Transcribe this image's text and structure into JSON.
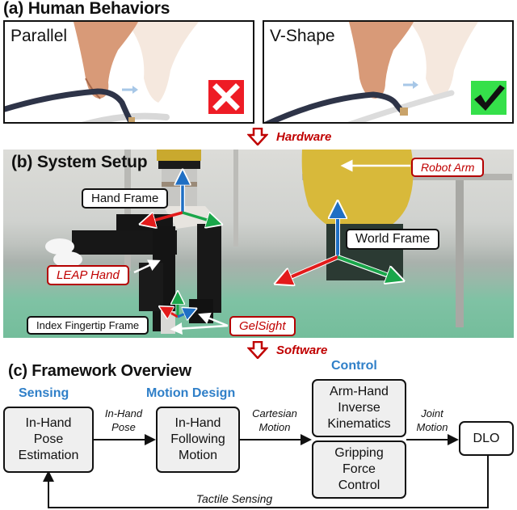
{
  "section_a": {
    "title": "(a) Human Behaviors",
    "panels": [
      {
        "label": "Parallel",
        "verdict": "x-mark-icon",
        "verdict_color": "#ee1c25"
      },
      {
        "label": "V-Shape",
        "verdict": "check-mark-icon",
        "verdict_color": "#35e04a"
      }
    ]
  },
  "transition_hardware": {
    "label": "Hardware",
    "icon": "down-arrow-icon",
    "color": "#c00000"
  },
  "section_b": {
    "title": "(b) System Setup",
    "callouts": {
      "hand_frame": "Hand Frame",
      "robot_arm": "Robot Arm",
      "world_frame": "World Frame",
      "leap_hand": "LEAP Hand",
      "index_fingertip_frame": "Index Fingertip Frame",
      "gelsight": "GelSight"
    },
    "axis_colors": {
      "x": "#e31b1b",
      "y": "#1aa64a",
      "z": "#1f6fc4"
    }
  },
  "transition_software": {
    "label": "Software",
    "icon": "down-arrow-icon",
    "color": "#c00000"
  },
  "section_c": {
    "title": "(c) Framework Overview",
    "columns": {
      "sensing": "Sensing",
      "motion_design": "Motion Design",
      "control": "Control"
    },
    "blocks": {
      "pose_estimation": [
        "In-Hand",
        "Pose",
        "Estimation"
      ],
      "following_motion": [
        "In-Hand",
        "Following",
        "Motion"
      ],
      "inverse_kinematics": [
        "Arm-Hand",
        "Inverse",
        "Kinematics"
      ],
      "gripping_force": [
        "Gripping",
        "Force",
        "Control"
      ],
      "dlo": "DLO"
    },
    "edges": {
      "in_hand_pose": [
        "In-Hand",
        "Pose"
      ],
      "cartesian_motion": [
        "Cartesian",
        "Motion"
      ],
      "joint_motion": [
        "Joint",
        "Motion"
      ],
      "tactile_sensing": "Tactile Sensing"
    },
    "accent_color": "#2f7fc8"
  }
}
